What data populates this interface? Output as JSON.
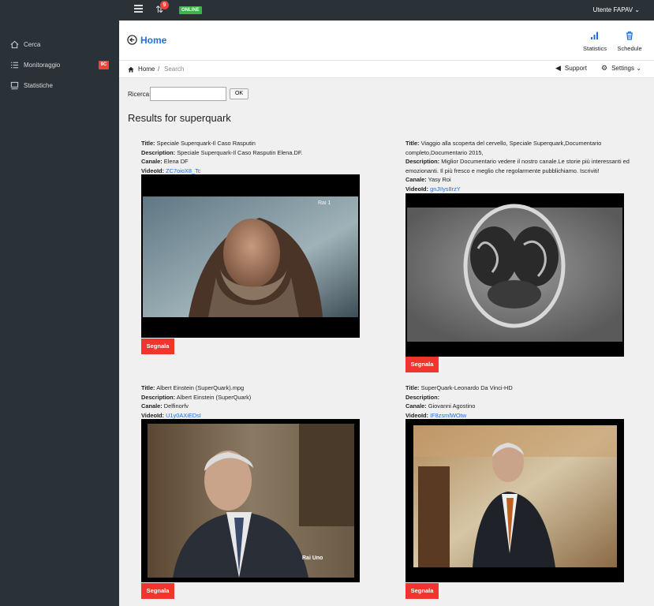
{
  "topbar": {
    "notifications_count": "9",
    "online_label": "ONLINE",
    "user_label": "Utente FAPAV ⌄"
  },
  "sidebar": {
    "items": [
      {
        "label": "Cerca",
        "icon": "home-icon"
      },
      {
        "label": "Monitoraggio",
        "icon": "list-icon",
        "badge": "9C"
      },
      {
        "label": "Statistiche",
        "icon": "monitor-icon"
      }
    ]
  },
  "header": {
    "title": "Home",
    "statistics_label": "Statistics",
    "schedule_label": "Schedule"
  },
  "breadcrumb": {
    "home": "Home",
    "separator": "/",
    "current": "Search",
    "support_label": "Support",
    "settings_label": "Settings ⌄"
  },
  "search": {
    "label": "Ricerca:",
    "value": "",
    "ok_label": "OK"
  },
  "results_heading": "Results for superquark",
  "labels": {
    "title": "Title:",
    "description": "Description:",
    "channel": "Canale:",
    "video_id": "VideoId:",
    "report_button": "Segnala"
  },
  "results": [
    {
      "title": "Speciale Superquark-Il Caso Rasputin",
      "description": "Speciale Superquark-Il Caso Rasputin Elena.DF.",
      "channel": "Elena DF",
      "video_id": "ZC7oioX8_Tc",
      "watermark": "Rai 1"
    },
    {
      "title": "Viaggio alla scoperta del cervello, Speciale Superquark,Documentario completo,Documentario 2015,",
      "description": "Miglior Documentario vedere il nostro canale.Le storie più interessanti ed emozionanti. Il più fresco e meglio che regolarmente pubblichiamo. Iscriviti!",
      "channel": "Yasy Roi",
      "video_id": "gnJIIys8rzY",
      "watermark": ""
    },
    {
      "title": "Albert Einstein (SuperQuark).mpg",
      "description": "Albert Einstein (SuperQuark)",
      "channel": "Delfinorfv",
      "video_id": "U1y0AXiEDsI",
      "watermark": "Rai Uno"
    },
    {
      "title": "SuperQuark-Leonardo Da Vinci-HD",
      "description": "",
      "channel": "Giovanni Agostino",
      "video_id": "IF8zsmlWOtw",
      "watermark": ""
    }
  ],
  "colors": {
    "dark_bg": "#2b3237",
    "accent_blue": "#1e6fd9",
    "report_red": "#f0352d",
    "online_green": "#3fb24b"
  }
}
